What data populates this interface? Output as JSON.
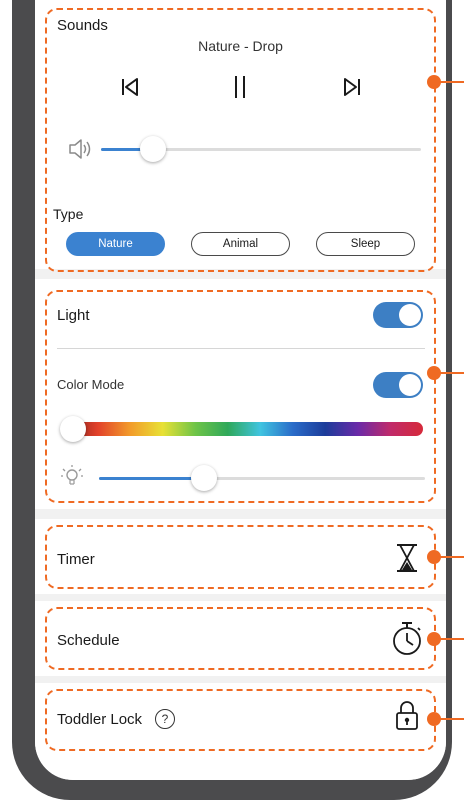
{
  "sounds": {
    "title": "Sounds",
    "now_playing": "Nature - Drop",
    "volume_level": 0.15,
    "type_label": "Type",
    "types": [
      "Nature",
      "Animal",
      "Sleep"
    ],
    "selected_type": "Nature"
  },
  "light": {
    "title": "Light",
    "enabled": true,
    "color_mode_label": "Color Mode",
    "color_mode_enabled": true,
    "hue_level": 0.0,
    "brightness_level": 0.33
  },
  "timer": {
    "title": "Timer"
  },
  "schedule": {
    "title": "Schedule"
  },
  "toddler_lock": {
    "title": "Toddler Lock",
    "help": "?"
  },
  "colors": {
    "accent": "#3b82d0",
    "callout": "#ef6a23",
    "frame": "#4b4b4d"
  },
  "icons": [
    "previous-icon",
    "pause-icon",
    "next-icon",
    "volume-icon",
    "bulb-icon",
    "hourglass-icon",
    "stopwatch-icon",
    "lock-icon",
    "help-icon"
  ]
}
